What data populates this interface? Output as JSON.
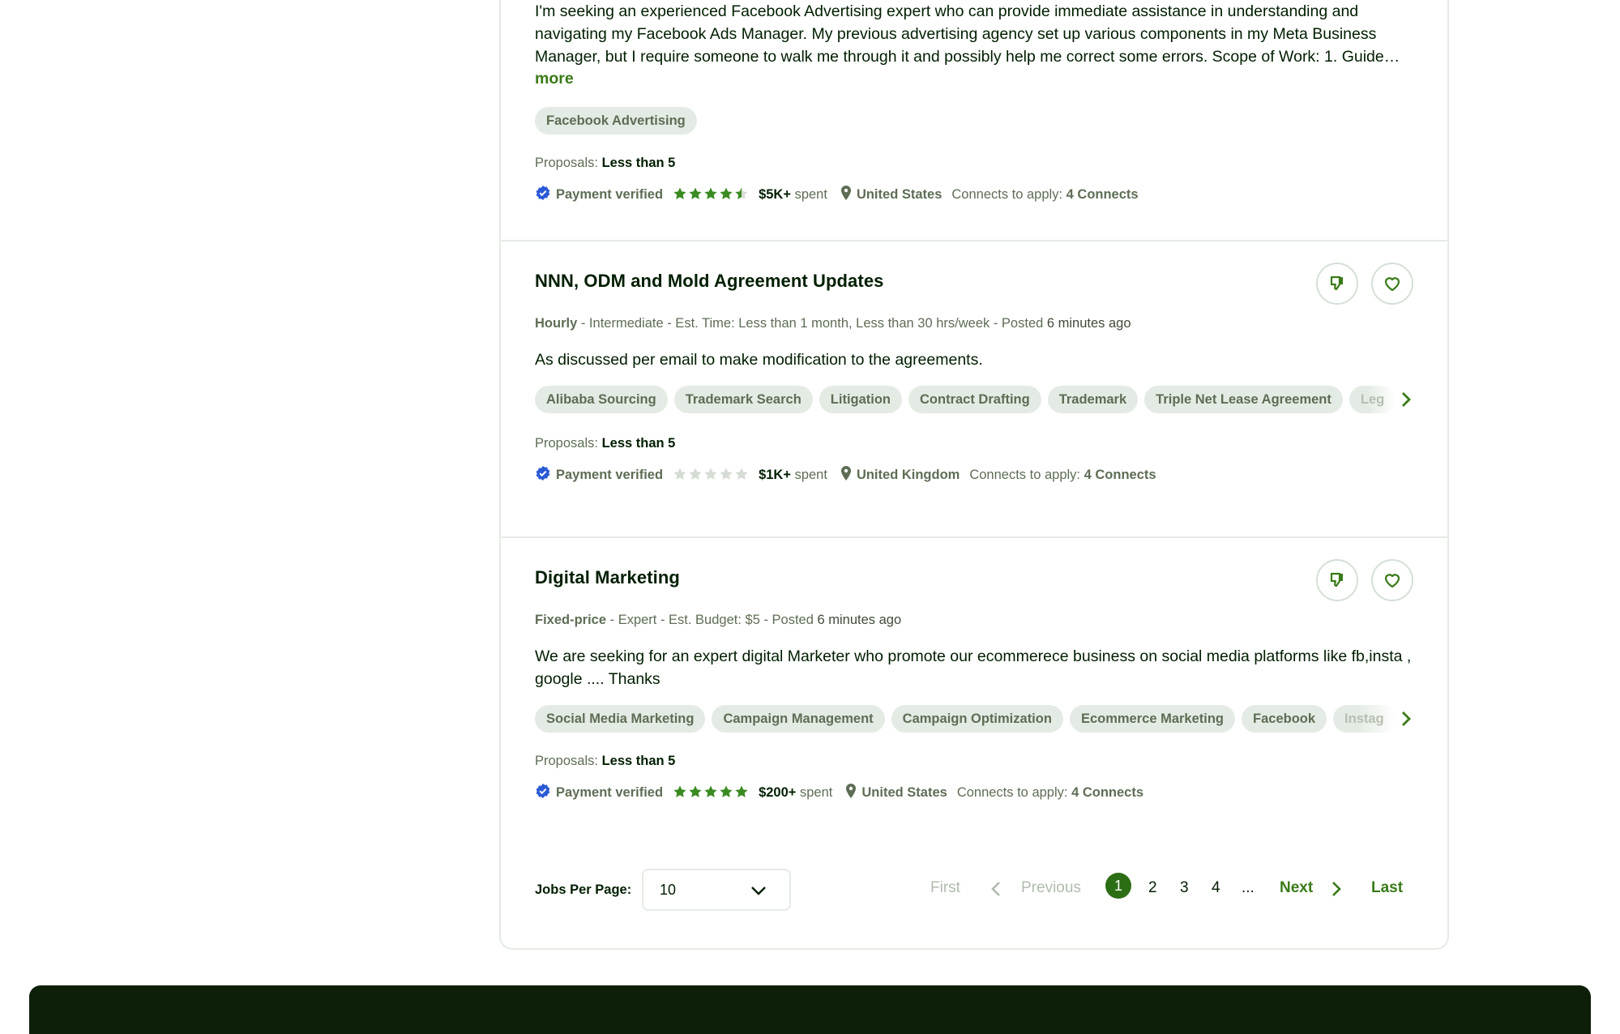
{
  "jobs": [
    {
      "description": "I'm seeking an experienced Facebook Advertising expert who can provide immediate assistance in understanding and navigating my Facebook Ads Manager. My previous advertising agency set up various components in my Meta Business Manager, but I require someone to walk me through it and possibly help me correct some errors. Scope of Work: 1. Guide…",
      "more_label": "more",
      "tags": [
        "Facebook Advertising"
      ],
      "proposals_label": "Proposals:",
      "proposals_value": "Less than 5",
      "payment": "Payment verified",
      "rating": 4.5,
      "spent_amount": "$5K+",
      "spent_label": "spent",
      "location": "United States",
      "connects_label": "Connects to apply:",
      "connects_value": "4 Connects"
    },
    {
      "title": "NNN, ODM and Mold Agreement Updates",
      "type": "Hourly",
      "meta_rest": " - Intermediate - Est. Time: Less than 1 month, Less than 30 hrs/week - Posted ",
      "posted": "6 minutes ago",
      "description": "As discussed per email to make modification to the agreements.",
      "tags": [
        "Alibaba Sourcing",
        "Trademark Search",
        "Litigation",
        "Contract Drafting",
        "Trademark",
        "Triple Net Lease Agreement",
        "Leg"
      ],
      "proposals_label": "Proposals:",
      "proposals_value": "Less than 5",
      "payment": "Payment verified",
      "rating": 0,
      "spent_amount": "$1K+",
      "spent_label": "spent",
      "location": "United Kingdom",
      "connects_label": "Connects to apply:",
      "connects_value": "4 Connects"
    },
    {
      "title": "Digital Marketing",
      "type": "Fixed-price",
      "meta_rest": " - Expert - Est. Budget: $5 - Posted ",
      "posted": "6 minutes ago",
      "description": "We are seeking for an expert digital Marketer who promote our ecommerece business on social media platforms like fb,insta , google .... Thanks",
      "tags": [
        "Social Media Marketing",
        "Campaign Management",
        "Campaign Optimization",
        "Ecommerce Marketing",
        "Facebook",
        "Instag"
      ],
      "proposals_label": "Proposals:",
      "proposals_value": "Less than 5",
      "payment": "Payment verified",
      "rating": 5,
      "spent_amount": "$200+",
      "spent_label": "spent",
      "location": "United States",
      "connects_label": "Connects to apply:",
      "connects_value": "4 Connects"
    }
  ],
  "pagination": {
    "jobs_per_page_label": "Jobs Per Page:",
    "jobs_per_page_value": "10",
    "first": "First",
    "previous": "Previous",
    "pages": [
      "1",
      "2",
      "3",
      "4"
    ],
    "ellipsis": "...",
    "next": "Next",
    "last": "Last",
    "current_page": 1
  },
  "colors": {
    "accent_green": "#14a800",
    "star_green": "#3a8a22",
    "verified_blue": "#2a5ad6",
    "footer": "#0d1f09"
  },
  "icons": {
    "dislike": "thumbs-down-icon",
    "save": "heart-icon",
    "verified": "verified-badge-icon",
    "location": "location-pin-icon",
    "tag_scroll": "chevron-right-icon",
    "dropdown": "chevron-down-icon"
  }
}
